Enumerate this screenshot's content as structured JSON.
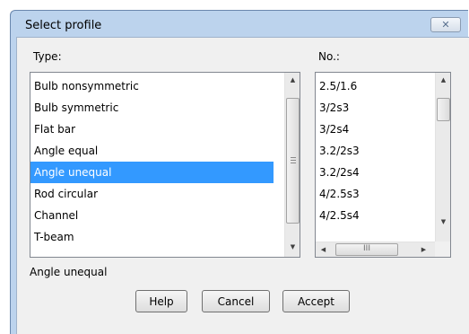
{
  "window": {
    "title": "Select profile",
    "close_glyph": "✕"
  },
  "type_list": {
    "label": "Type:",
    "items": [
      "Bulb nonsymmetric",
      "Bulb symmetric",
      "Flat bar",
      "Angle equal",
      "Angle unequal",
      "Rod circular",
      "Channel",
      "T-beam"
    ],
    "selected": "Angle unequal"
  },
  "no_list": {
    "label": "No.:",
    "items": [
      "2.5/1.6",
      "3/2s3",
      "3/2s4",
      "3.2/2s3",
      "3.2/2s4",
      "4/2.5s3",
      "4/2.5s4"
    ]
  },
  "status_text": "Angle unequal",
  "buttons": {
    "help": "Help",
    "cancel": "Cancel",
    "accept": "Accept"
  },
  "icons": {
    "scroll_up": "▲",
    "scroll_down": "▼",
    "scroll_left": "◀",
    "scroll_right": "▶",
    "grip": "III"
  },
  "colors": {
    "selection": "#3399ff",
    "frame": "#bcd3ed"
  }
}
